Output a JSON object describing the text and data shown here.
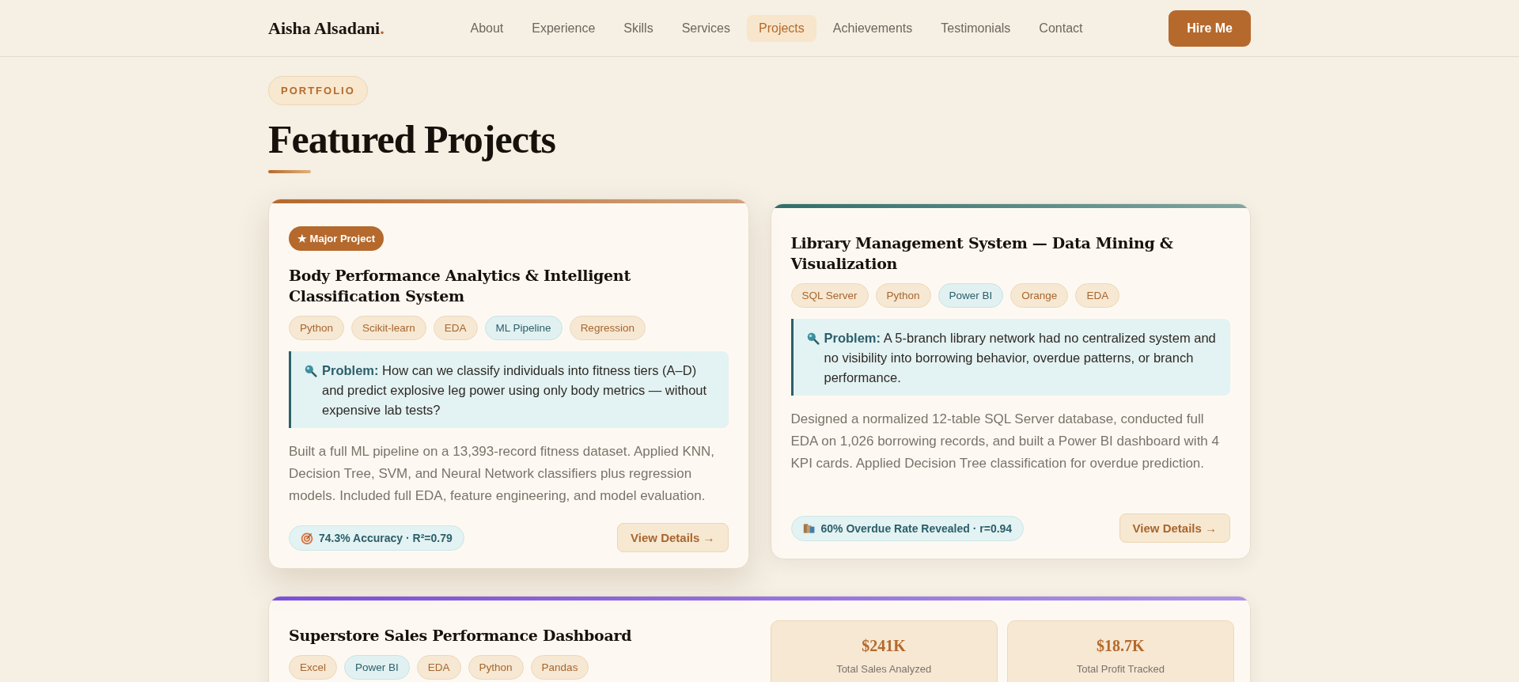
{
  "nav": {
    "logo": "Aisha Alsadani",
    "logo_dot": ".",
    "items": [
      {
        "label": "About",
        "selected": false
      },
      {
        "label": "Experience",
        "selected": false
      },
      {
        "label": "Skills",
        "selected": false
      },
      {
        "label": "Services",
        "selected": false
      },
      {
        "label": "Projects",
        "selected": true
      },
      {
        "label": "Achievements",
        "selected": false
      },
      {
        "label": "Testimonials",
        "selected": false
      },
      {
        "label": "Contact",
        "selected": false
      }
    ],
    "cta": "Hire Me"
  },
  "section": {
    "eyebrow": "PORTFOLIO",
    "title": "Featured Projects"
  },
  "projects": [
    {
      "color": "#b5692c",
      "badge": "★ Major Project",
      "title": "Body Performance Analytics & Intelligent Classification System",
      "tags": [
        {
          "label": "Python",
          "kind": "tool"
        },
        {
          "label": "Scikit-learn",
          "kind": "tool"
        },
        {
          "label": "EDA",
          "kind": "tool"
        },
        {
          "label": "ML Pipeline",
          "kind": "accent"
        },
        {
          "label": "Regression",
          "kind": "tool"
        }
      ],
      "problem": "**Problem:** How can we classify individuals into fitness tiers (A–D) and predict explosive leg power using only body metrics — without expensive lab tests?",
      "description": "Built a full ML pipeline on a 13,393-record fitness dataset. Applied KNN, Decision Tree, SVM, and Neural Network classifiers plus regression models. Included full EDA, feature engineering, and model evaluation.",
      "metric": {
        "kind": "target",
        "text": "74.3% Accuracy · R²=0.79"
      },
      "button": "View Details →"
    },
    {
      "color": "#2f6e6a",
      "title": "Library Management System — Data Mining & Visualization",
      "tags": [
        {
          "label": "SQL Server",
          "kind": "tool"
        },
        {
          "label": "Python",
          "kind": "tool"
        },
        {
          "label": "Power BI",
          "kind": "accent"
        },
        {
          "label": "Orange",
          "kind": "tool"
        },
        {
          "label": "EDA",
          "kind": "tool"
        }
      ],
      "problem": "**Problem:** A 5-branch library network had no centralized system and no visibility into borrowing behavior, overdue patterns, or branch performance.",
      "description": "Designed a normalized 12-table SQL Server database, conducted full EDA on 1,026 borrowing records, and built a Power BI dashboard with 4 KPI cards. Applied Decision Tree classification for overdue prediction.",
      "metric": {
        "kind": "books",
        "text": "60% Overdue Rate Revealed · r=0.94"
      },
      "button": "View Details →"
    }
  ],
  "wide_project": {
    "color": "#7b4fe0",
    "title": "Superstore Sales Performance Dashboard",
    "tags": [
      {
        "label": "Excel",
        "kind": "tool"
      },
      {
        "label": "Power BI",
        "kind": "accent"
      },
      {
        "label": "EDA",
        "kind": "tool"
      },
      {
        "label": "Python",
        "kind": "tool"
      },
      {
        "label": "Pandas",
        "kind": "tool"
      }
    ],
    "stats": [
      {
        "value": "$241K",
        "label": "Total Sales Analyzed"
      },
      {
        "value": "$18.7K",
        "label": "Total Profit Tracked"
      }
    ]
  }
}
